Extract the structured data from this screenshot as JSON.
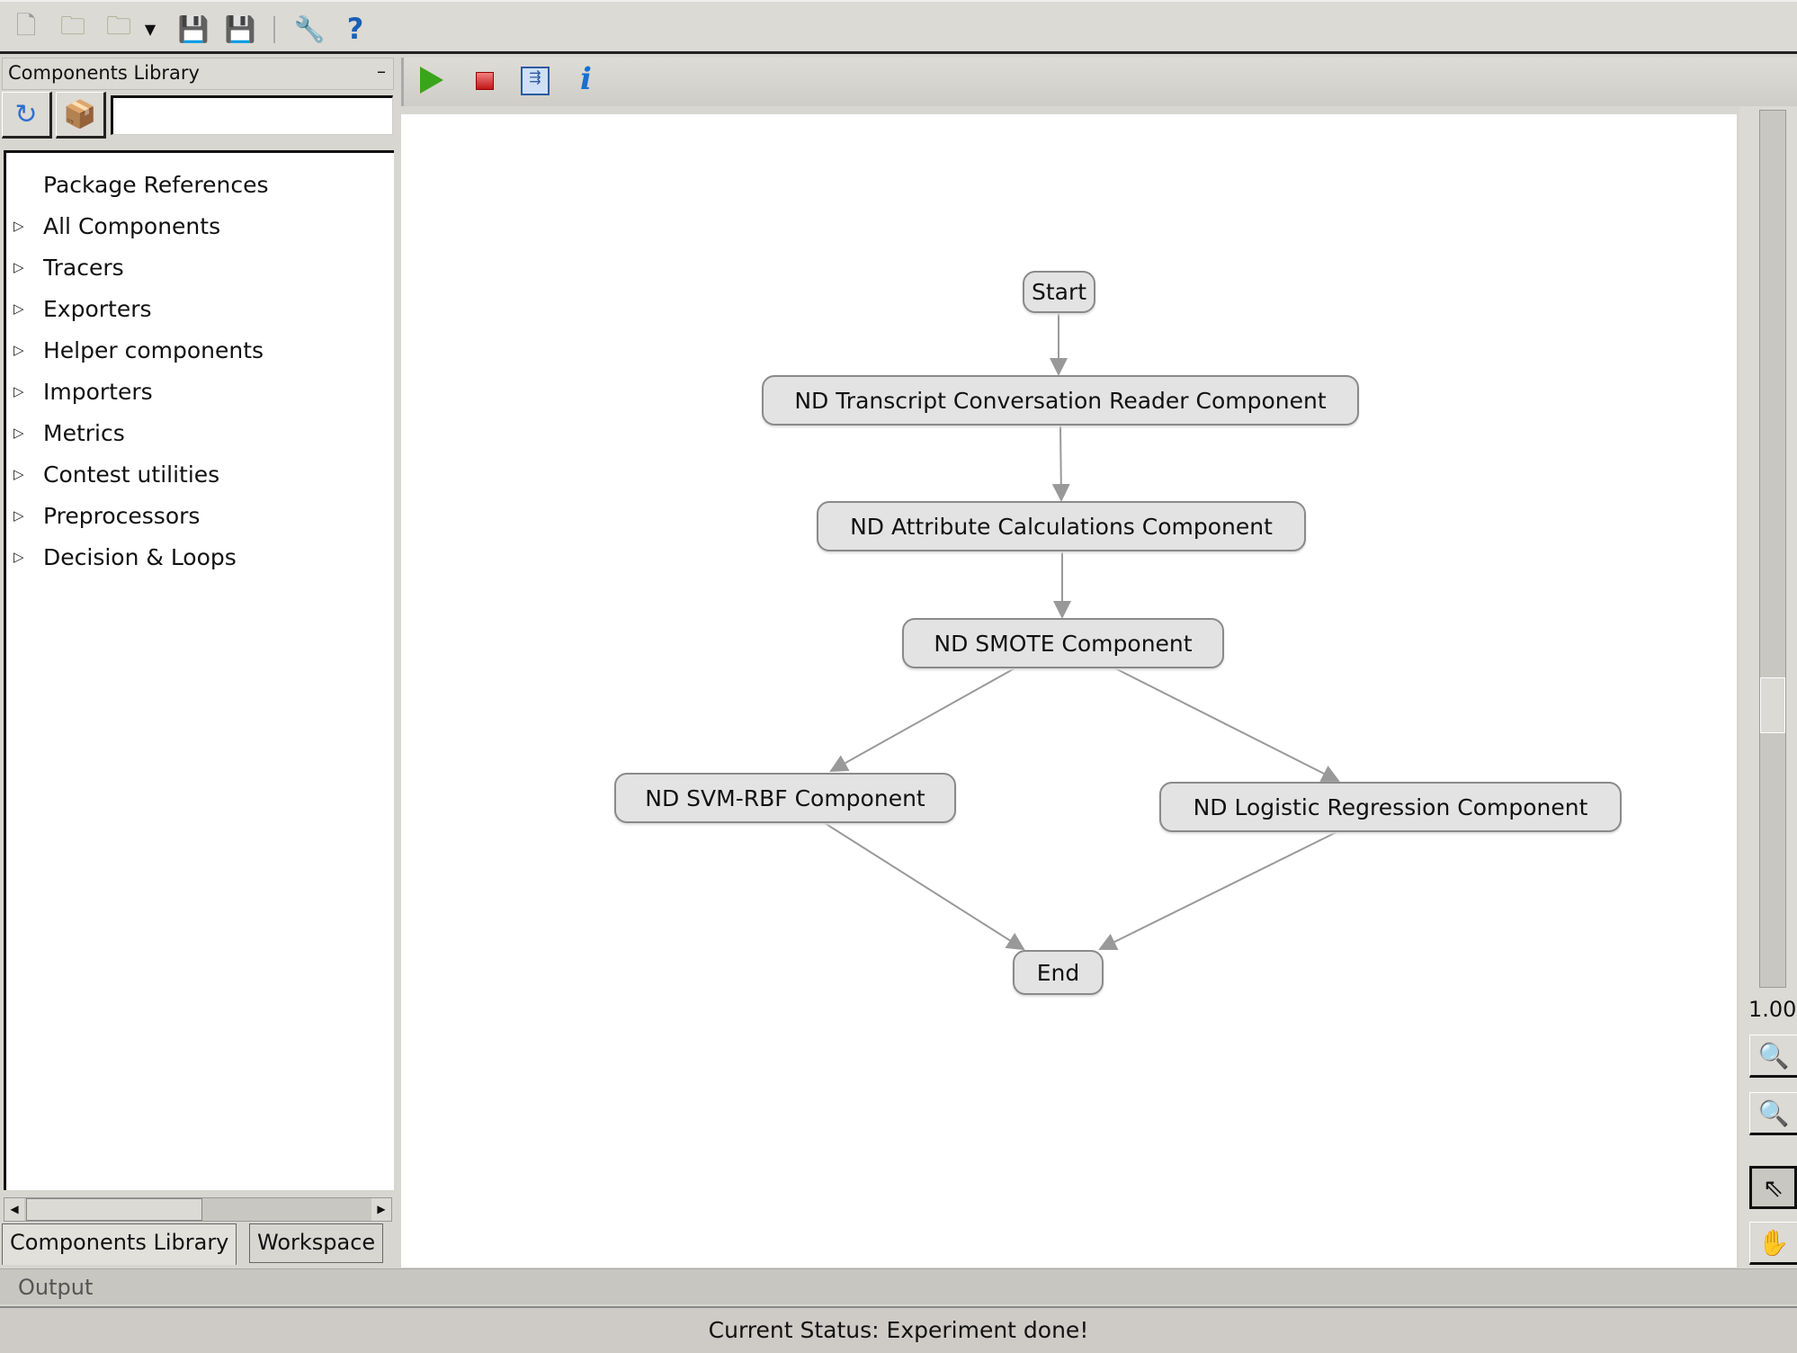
{
  "toolbar": {
    "icons": [
      "new-file-icon",
      "open-folder-icon",
      "open-recent-folder-icon",
      "dropdown-arrow-icon",
      "save-icon",
      "save-as-icon",
      "tools-icon",
      "help-icon"
    ]
  },
  "left_panel": {
    "title": "Components Library",
    "minimize": "–",
    "search": {
      "value": "",
      "placeholder": ""
    },
    "tree": [
      {
        "label": "Package References",
        "expandable": false
      },
      {
        "label": "All Components",
        "expandable": true
      },
      {
        "label": "Tracers",
        "expandable": true
      },
      {
        "label": "Exporters",
        "expandable": true
      },
      {
        "label": "Helper components",
        "expandable": true
      },
      {
        "label": "Importers",
        "expandable": true
      },
      {
        "label": "Metrics",
        "expandable": true
      },
      {
        "label": "Contest utilities",
        "expandable": true
      },
      {
        "label": "Preprocessors",
        "expandable": true
      },
      {
        "label": "Decision & Loops",
        "expandable": true
      }
    ],
    "tabs": [
      {
        "label": "Components Library",
        "active": true
      },
      {
        "label": "Workspace",
        "active": false
      }
    ]
  },
  "canvas_toolbar": {
    "icons": [
      "run-icon",
      "stop-icon",
      "workflow-icon",
      "info-icon"
    ]
  },
  "graph": {
    "nodes": {
      "start": "Start",
      "transcript": "ND Transcript Conversation Reader Component",
      "attr": "ND Attribute Calculations Component",
      "smote": "ND SMOTE Component",
      "svm": "ND SVM-RBF Component",
      "logreg": "ND Logistic Regression Component",
      "end": "End"
    },
    "edges": [
      [
        "start",
        "transcript"
      ],
      [
        "transcript",
        "attr"
      ],
      [
        "attr",
        "smote"
      ],
      [
        "smote",
        "svm"
      ],
      [
        "smote",
        "logreg"
      ],
      [
        "svm",
        "end"
      ],
      [
        "logreg",
        "end"
      ]
    ]
  },
  "zoom": {
    "level": "1.00"
  },
  "output": {
    "label": "Output"
  },
  "status": {
    "text": "Current Status: Experiment done!"
  },
  "colors": {
    "node_fill": "#e3e3e3",
    "node_border": "#8a8a8a",
    "edge": "#999999",
    "run": "#3aa51a",
    "stop": "#d02828"
  }
}
